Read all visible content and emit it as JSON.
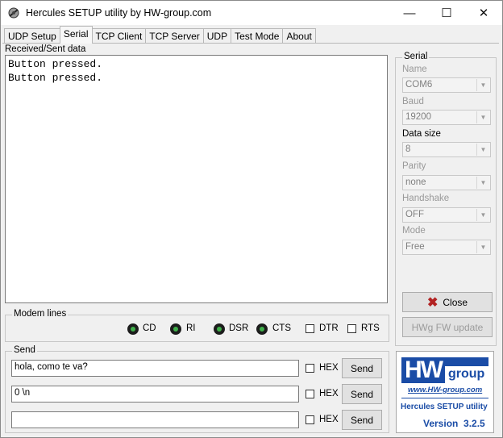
{
  "window": {
    "title": "Hercules SETUP utility by HW-group.com",
    "minimize": "—",
    "maximize": "☐",
    "close": "✕"
  },
  "tabs": [
    "UDP Setup",
    "Serial",
    "TCP Client",
    "TCP Server",
    "UDP",
    "Test Mode",
    "About"
  ],
  "received": {
    "label": "Received/Sent data",
    "lines": [
      "Button pressed.",
      "Button pressed."
    ]
  },
  "serial": {
    "title": "Serial",
    "name_label": "Name",
    "name_value": "COM6",
    "baud_label": "Baud",
    "baud_value": "19200",
    "datasize_label": "Data size",
    "datasize_value": "8",
    "parity_label": "Parity",
    "parity_value": "none",
    "handshake_label": "Handshake",
    "handshake_value": "OFF",
    "mode_label": "Mode",
    "mode_value": "Free",
    "close_button": "Close",
    "fw_button": "HWg FW update"
  },
  "modem": {
    "title": "Modem lines",
    "cd": "CD",
    "ri": "RI",
    "dsr": "DSR",
    "cts": "CTS",
    "dtr": "DTR",
    "rts": "RTS"
  },
  "send": {
    "title": "Send",
    "rows": [
      {
        "value": "hola, como te va?",
        "hex": "HEX",
        "button": "Send"
      },
      {
        "value": "0 \\n",
        "hex": "HEX",
        "button": "Send"
      },
      {
        "value": "",
        "hex": "HEX",
        "button": "Send"
      }
    ]
  },
  "logo": {
    "brand_hw": "HW",
    "brand_group": "group",
    "url": "www.HW-group.com",
    "product": "Hercules SETUP utility",
    "version": "Version  3.2.5"
  },
  "colors": {
    "brand_blue": "#1a4ca6",
    "close_x": "#b22222",
    "led_green": "#3fb04a"
  }
}
